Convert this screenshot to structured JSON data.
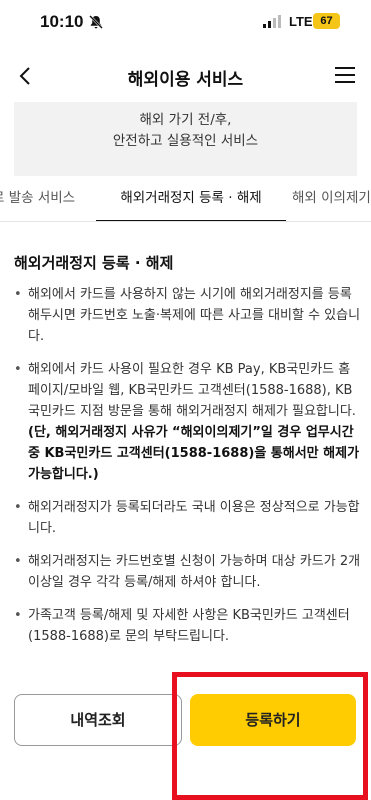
{
  "status_bar": {
    "time": "10:10",
    "network": "LTE",
    "battery": "67"
  },
  "header": {
    "title": "해외이용 서비스",
    "back_icon": "chevron-left-icon",
    "menu_icon": "hamburger-menu-icon"
  },
  "banner": {
    "line1": "해외 가기 전/후,",
    "line2": "안전하고 실용적인 서비스"
  },
  "tabs": [
    {
      "label": "로 발송 서비스"
    },
    {
      "label": "해외거래정지 등록 · 해제",
      "active": true
    },
    {
      "label": "해외 이의제기"
    }
  ],
  "section": {
    "title": "해외거래정지 등록 · 해제",
    "bullets": [
      "해외에서 카드를 사용하지 않는 시기에 해외거래정지를 등록해두시면 카드번호 노출·복제에 따른 사고를 대비할 수 있습니다.",
      "해외에서 카드 사용이 필요한 경우 KB Pay, KB국민카드 홈페이지/모바일 웹, KB국민카드 고객센터(1588-1688), KB국민카드 지점 방문을 통해 해외거래정지 해제가 필요합니다.",
      "해외거래정지가 등록되더라도 국내 이용은 정상적으로 가능합니다.",
      "해외거래정지는 카드번호별 신청이 가능하며 대상 카드가 2개 이상일 경우 각각 등록/해제 하셔야 합니다.",
      "가족고객 등록/해제 및 자세한 사항은 KB국민카드 고객센터(1588-1688)로 문의 부탁드립니다."
    ],
    "bullet2_note": "(단, 해외거래정지 사유가 “해외이의제기”일 경우 업무시간 중 KB국민카드 고객센터(1588-1688)을 통해서만 해제가 가능합니다.)"
  },
  "buttons": {
    "history": "내역조회",
    "register": "등록하기"
  },
  "colors": {
    "accent": "#fecc00",
    "highlight": "#e8101e",
    "banner_bg": "#f2f2f2"
  }
}
